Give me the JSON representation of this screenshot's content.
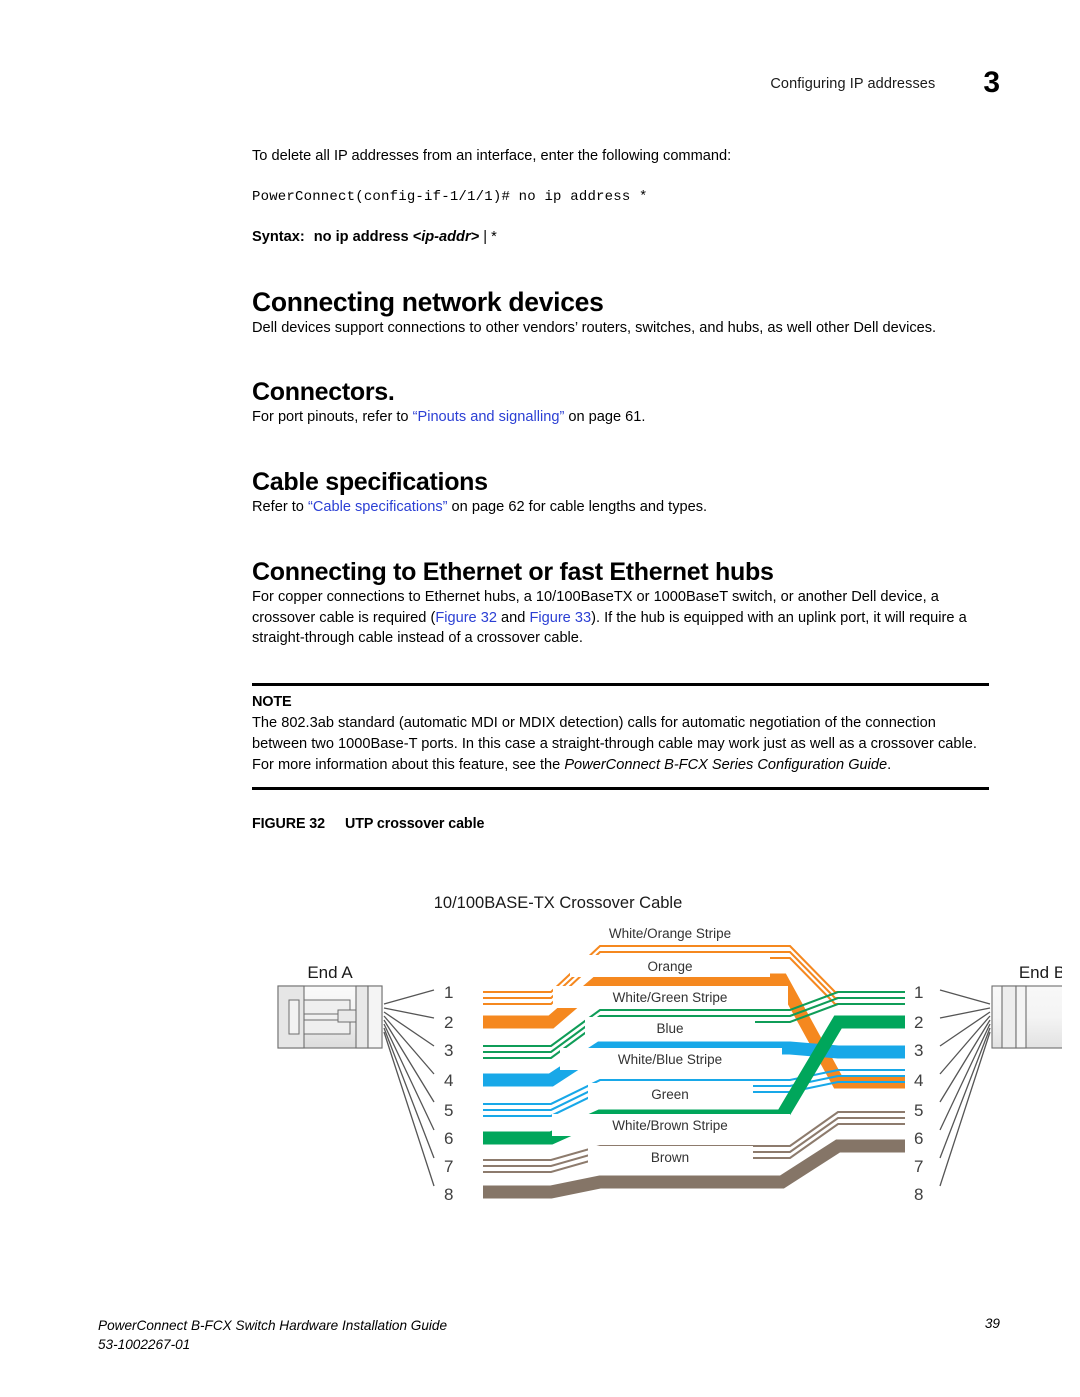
{
  "header": {
    "running_title": "Configuring IP addresses",
    "chapter_number": "3"
  },
  "intro": {
    "lead": "To delete all IP addresses from an interface, enter the following command:",
    "code": "PowerConnect(config-if-1/1/1)# no ip address *",
    "syntax_label": "Syntax:",
    "syntax_command": "no ip address",
    "syntax_param": "<ip-addr>",
    "syntax_tail": "| *"
  },
  "sections": {
    "connecting_network_devices": {
      "heading": "Connecting network devices",
      "body": "Dell devices support connections to other vendors’ routers, switches, and hubs, as well other Dell devices."
    },
    "connectors": {
      "heading": "Connectors.",
      "body_pre": "For port pinouts, refer to ",
      "link": "“Pinouts and signalling”",
      "body_post": " on page 61."
    },
    "cable_specifications": {
      "heading": "Cable specifications",
      "body_pre": "Refer to ",
      "link": "“Cable specifications”",
      "body_post": " on page 62 for cable lengths and types."
    },
    "connecting_to_hubs": {
      "heading": "Connecting to Ethernet or fast Ethernet hubs",
      "body_1": "For copper connections to Ethernet hubs, a 10/100BaseTX or 1000BaseT switch, or another Dell device, a crossover cable is required (",
      "link_1": "Figure 32",
      "body_2": " and ",
      "link_2": "Figure 33",
      "body_3": "). If the hub is equipped with an uplink port, it will require a straight-through cable instead of a crossover cable."
    }
  },
  "note": {
    "label": "NOTE",
    "text_1": "The 802.3ab standard (automatic MDI or MDIX detection) calls for automatic negotiation of the connection between two 1000Base-T ports. In this case a straight-through cable may work just as well as a crossover cable. For more information about this feature, see the ",
    "italic": "PowerConnect B-FCX Series Configuration Guide",
    "text_2": "."
  },
  "figure": {
    "caption_number": "FIGURE 32",
    "caption_title": "UTP crossover cable",
    "diagram_title": "10/100BASE-TX Crossover Cable",
    "end_a_label": "End A",
    "end_b_label": "End B",
    "pins_left": [
      "1",
      "2",
      "3",
      "4",
      "5",
      "6",
      "7",
      "8"
    ],
    "pins_right": [
      "1",
      "2",
      "3",
      "4",
      "5",
      "6",
      "7",
      "8"
    ],
    "wire_labels": [
      "White/Orange Stripe",
      "Orange",
      "White/Green Stripe",
      "Blue",
      "White/Blue Stripe",
      "Green",
      "White/Brown Stripe",
      "Brown"
    ],
    "colors": {
      "orange": "#F5881F",
      "green": "#00A65B",
      "blue": "#18A8E8",
      "brown": "#857567",
      "pin_text": "#404040",
      "label_text": "#333333",
      "connector_body": "#EDEDED",
      "connector_stroke": "#6E6E6E"
    },
    "crossover_map": [
      {
        "from": "1",
        "to": "3"
      },
      {
        "from": "2",
        "to": "6"
      },
      {
        "from": "3",
        "to": "1"
      },
      {
        "from": "4",
        "to": "4"
      },
      {
        "from": "5",
        "to": "5"
      },
      {
        "from": "6",
        "to": "2"
      },
      {
        "from": "7",
        "to": "7"
      },
      {
        "from": "8",
        "to": "8"
      }
    ]
  },
  "footer": {
    "guide_title": "PowerConnect B-FCX Switch Hardware Installation Guide",
    "doc_number": "53-1002267-01",
    "page_number": "39"
  }
}
